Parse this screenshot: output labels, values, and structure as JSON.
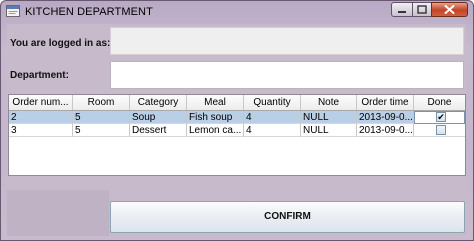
{
  "window": {
    "title": "KITCHEN DEPARTMENT"
  },
  "form": {
    "logged_in_label": "You are logged in as:",
    "logged_in_value": "",
    "department_label": "Department:",
    "department_value": ""
  },
  "table": {
    "columns": [
      "Order num...",
      "Room",
      "Category",
      "Meal",
      "Quantity",
      "Note",
      "Order time",
      "Done"
    ],
    "rows": [
      {
        "order_num": "2",
        "room": "5",
        "category": "Soup",
        "meal": "Fish soup",
        "quantity": "4",
        "note": "NULL",
        "order_time": "2013-09-0...",
        "done": "✔",
        "selected": true
      },
      {
        "order_num": "3",
        "room": "5",
        "category": "Dessert",
        "meal": "Lemon ca...",
        "quantity": "4",
        "note": "NULL",
        "order_time": "2013-09-0...",
        "done": "",
        "selected": false
      }
    ]
  },
  "actions": {
    "confirm_label": "CONFIRM"
  },
  "colors": {
    "selection": "#b8cfe5",
    "window_frame": "#c7bacb",
    "close_button": "#c2432a"
  }
}
